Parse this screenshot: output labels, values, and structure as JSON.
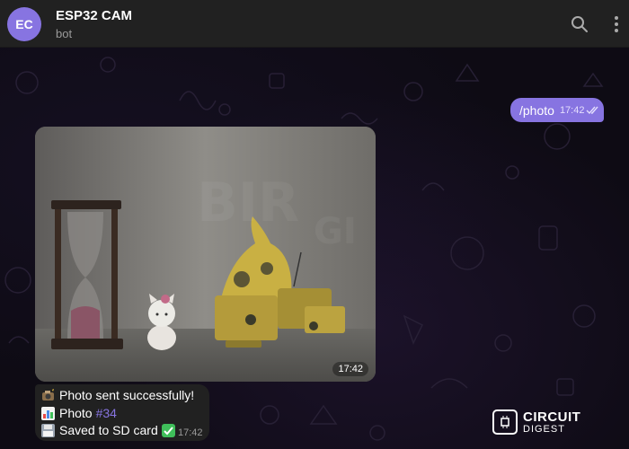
{
  "chat": {
    "avatar_initials": "EC",
    "title": "ESP32 CAM",
    "subtitle": "bot",
    "accent_color": "#8774e1"
  },
  "header_icons": [
    "search-icon",
    "more-vertical-icon"
  ],
  "messages": {
    "outgoing": {
      "text": "/photo",
      "time": "17:42",
      "status_icon": "double-check-icon"
    },
    "photo": {
      "time": "17:42",
      "description_icons": [
        "hourglass",
        "cat-figurine",
        "robot-dinosaur"
      ]
    },
    "incoming": {
      "line1": {
        "icon": "camera-flash-emoji",
        "text": "Photo sent successfully!"
      },
      "line2": {
        "icon": "bar-chart-emoji",
        "text": "Photo",
        "tag": "#34"
      },
      "line3": {
        "icon": "floppy-disk-emoji",
        "text": "Saved to SD card",
        "icon_after": "check-mark-button-emoji"
      },
      "time": "17:42"
    }
  },
  "watermark": {
    "line1": "CIRCUIT",
    "line2": "DIGEST"
  }
}
